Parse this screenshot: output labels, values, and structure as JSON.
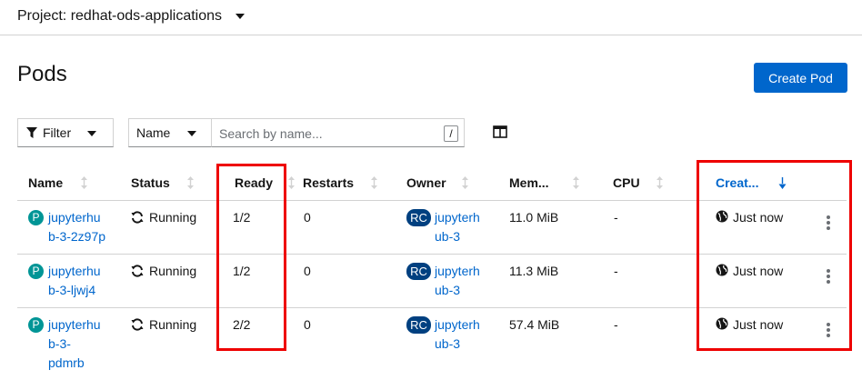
{
  "project": {
    "label": "Project: redhat-ods-applications"
  },
  "page": {
    "title": "Pods",
    "create_button": "Create Pod"
  },
  "toolbar": {
    "filter_label": "Filter",
    "search_by": "Name",
    "search_placeholder": "Search by name...",
    "slash_hint": "/"
  },
  "table": {
    "headers": {
      "name": "Name",
      "status": "Status",
      "ready": "Ready",
      "restarts": "Restarts",
      "owner": "Owner",
      "memory": "Mem...",
      "cpu": "CPU",
      "created": "Creat..."
    },
    "rows": [
      {
        "badge": "P",
        "name_lines": [
          "jupyterhu",
          "b-3-2z97p"
        ],
        "status": "Running",
        "ready": "1/2",
        "restarts": "0",
        "owner_badge": "RC",
        "owner_lines": [
          "jupyterh",
          "ub-3"
        ],
        "memory": "11.0 MiB",
        "cpu": "-",
        "created": "Just now"
      },
      {
        "badge": "P",
        "name_lines": [
          "jupyterhu",
          "b-3-ljwj4"
        ],
        "status": "Running",
        "ready": "1/2",
        "restarts": "0",
        "owner_badge": "RC",
        "owner_lines": [
          "jupyterh",
          "ub-3"
        ],
        "memory": "11.3 MiB",
        "cpu": "-",
        "created": "Just now"
      },
      {
        "badge": "P",
        "name_lines": [
          "jupyterhu",
          "b-3-",
          "pdmrb"
        ],
        "status": "Running",
        "ready": "2/2",
        "restarts": "0",
        "owner_badge": "RC",
        "owner_lines": [
          "jupyterh",
          "ub-3"
        ],
        "memory": "57.4 MiB",
        "cpu": "-",
        "created": "Just now"
      }
    ]
  },
  "colors": {
    "accent": "#0066cc",
    "pod_badge": "#009596",
    "owner_badge": "#004080",
    "highlight": "#ee0000"
  },
  "icons": [
    "caret-down-icon",
    "filter-icon",
    "columns-icon",
    "sort-icon",
    "sort-down-icon",
    "sync-icon",
    "globe-icon",
    "kebab-icon"
  ]
}
